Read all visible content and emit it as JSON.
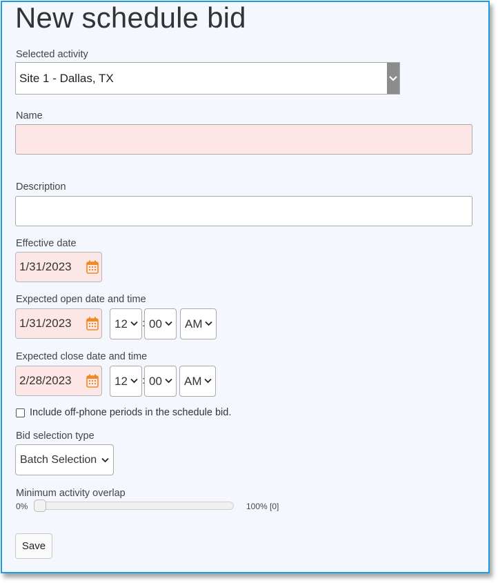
{
  "page": {
    "title": "New schedule bid"
  },
  "activity": {
    "label": "Selected activity",
    "value": "Site 1 - Dallas, TX"
  },
  "name": {
    "label": "Name",
    "value": ""
  },
  "description": {
    "label": "Description",
    "value": ""
  },
  "effective": {
    "label": "Effective date",
    "date": "1/31/2023"
  },
  "open": {
    "label": "Expected open date and time",
    "date": "1/31/2023",
    "hour": "12",
    "minute": "00",
    "ampm": "AM"
  },
  "close": {
    "label": "Expected close date and time",
    "date": "2/28/2023",
    "hour": "12",
    "minute": "00",
    "ampm": "AM"
  },
  "time_sep": ":",
  "offphone": {
    "label": "Include off-phone periods in the schedule bid.",
    "checked": false
  },
  "bid_type": {
    "label": "Bid selection type",
    "value": "Batch Selection"
  },
  "overlap": {
    "label": "Minimum activity overlap",
    "min_label": "0%",
    "max_label": "100%",
    "value_label": "[0]",
    "value": 0
  },
  "actions": {
    "save": "Save"
  },
  "colors": {
    "border_accent": "#1a9ee0",
    "required_bg": "#fde7e6",
    "calendar_icon": "#f08a24",
    "page_bg": "#f4f7fd"
  }
}
